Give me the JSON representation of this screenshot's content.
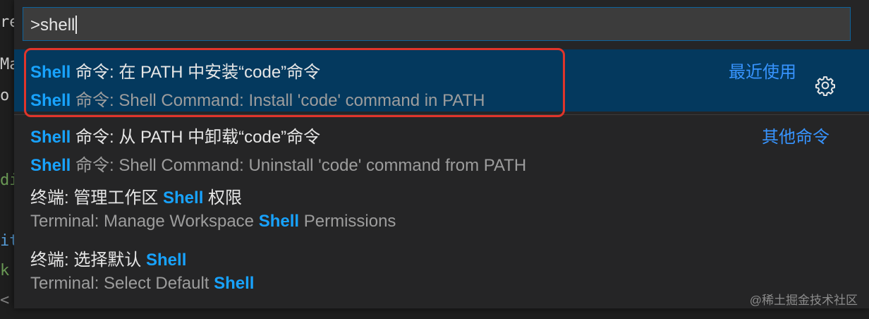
{
  "background_peek": {
    "lines": [
      {
        "text": "rea",
        "color": "#cccccc"
      },
      {
        "text": "Ma",
        "color": "#cccccc"
      },
      {
        "text": "o",
        "color": "#cccccc"
      },
      {
        "text": "di",
        "color": "#6a9955"
      },
      {
        "text": "it",
        "color": "#569cd6"
      },
      {
        "text": "k",
        "color": "#6a9955"
      },
      {
        "text": "<",
        "color": "#808080"
      }
    ]
  },
  "command_palette": {
    "input_value": ">shell",
    "items": [
      {
        "highlight": "Shell",
        "title_rest": " 命令: 在 PATH 中安装“code”命令",
        "detail_highlight": "Shell",
        "detail_rest": " 命令: Shell Command: Install 'code' command in PATH",
        "tag": "最近使用",
        "selected": true
      },
      {
        "highlight": "Shell",
        "title_rest": " 命令: 从 PATH 中卸载“code”命令",
        "detail_highlight": "Shell",
        "detail_rest": " 命令: Shell Command: Uninstall 'code' command from PATH",
        "tag": "其他命令",
        "selected": false
      },
      {
        "title_prefix": "终端: 管理工作区 ",
        "highlight": "Shell",
        "title_rest": " 权限",
        "detail_prefix": "Terminal: Manage Workspace ",
        "detail_highlight": "Shell",
        "detail_rest": " Permissions",
        "selected": false
      },
      {
        "title_prefix": "终端: 选择默认 ",
        "highlight": "Shell",
        "detail_prefix": "Terminal: Select Default ",
        "detail_highlight": "Shell",
        "selected": false
      }
    ],
    "gear_icon": "gear-icon"
  },
  "watermark": "@稀土掘金技术社区",
  "colors": {
    "highlight": "#18a3ff",
    "selected_bg": "#04395e",
    "annotation_border": "#e0352b"
  }
}
